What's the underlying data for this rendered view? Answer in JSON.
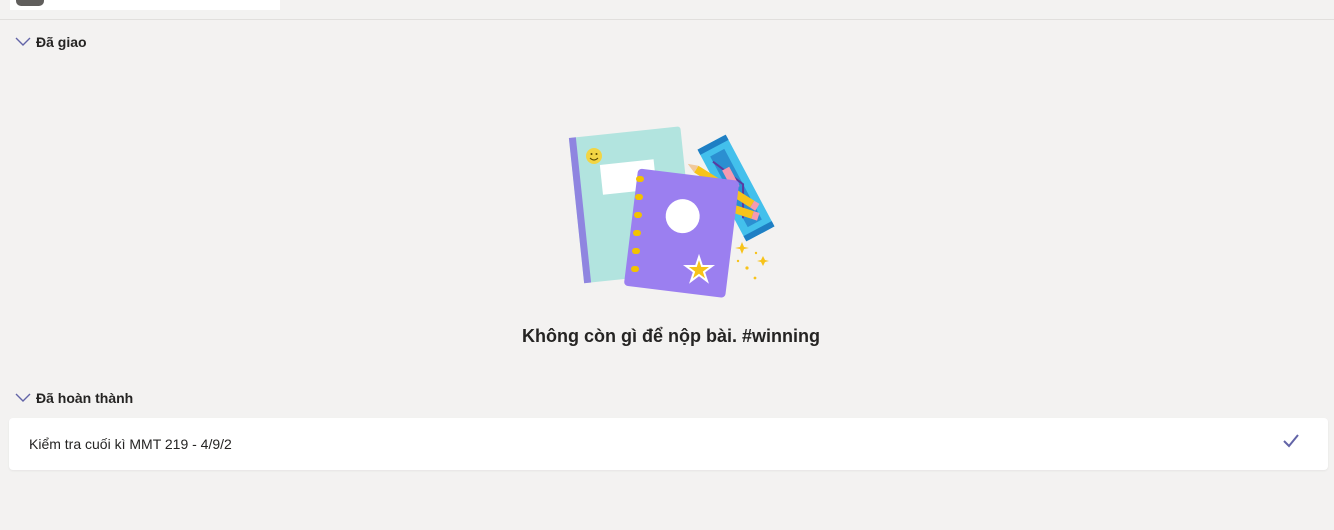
{
  "sections": {
    "assigned": {
      "label": "Đã giao",
      "empty_message": "Không còn gì để nộp bài. #winning"
    },
    "completed": {
      "label": "Đã hoàn thành",
      "items": [
        {
          "title": "Kiểm tra cuối kì MMT 219 - 4/9/2",
          "status_icon": "checkmark-icon"
        }
      ]
    }
  },
  "icons": {
    "section_toggle": "chevron-down-icon",
    "empty_state": "notebook-illustration"
  },
  "colors": {
    "background": "#f3f2f1",
    "accent": "#6264a7",
    "card": "#ffffff"
  }
}
